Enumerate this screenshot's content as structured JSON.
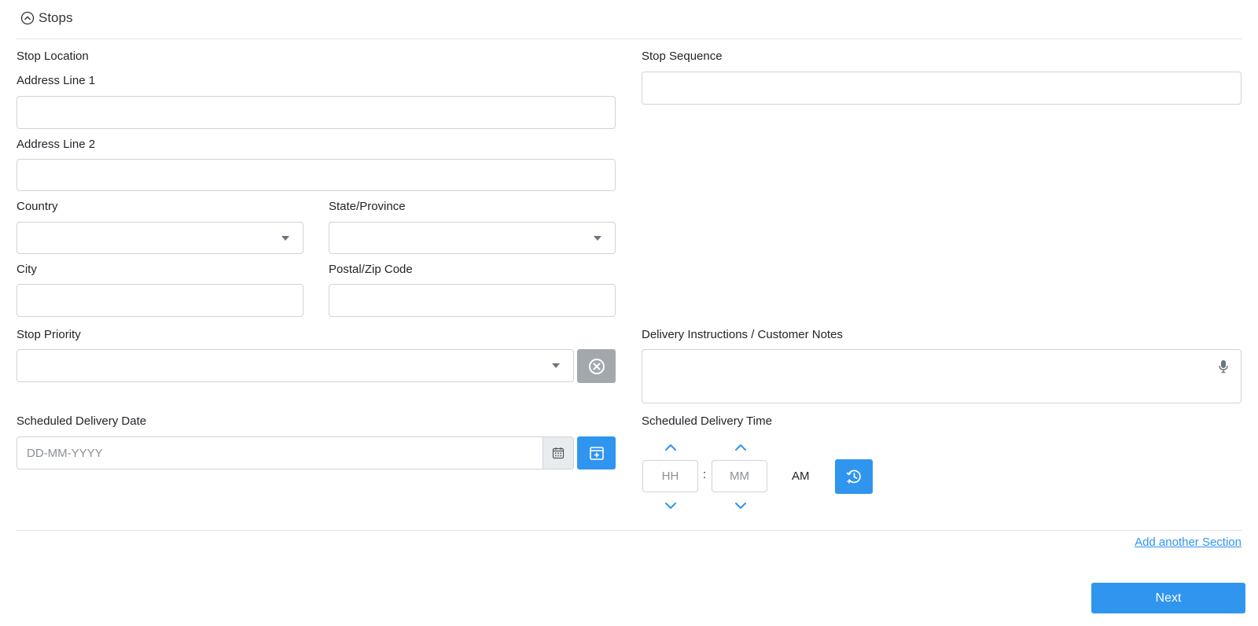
{
  "section": {
    "title": "Stops",
    "toggle_icon": "chevron-up-circle-icon"
  },
  "labels": {
    "stop_location": "Stop Location",
    "address_line_1": "Address Line 1",
    "address_line_2": "Address Line 2",
    "country": "Country",
    "state_province": "State/Province",
    "city": "City",
    "postal_zip": "Postal/Zip Code",
    "stop_priority": "Stop Priority",
    "scheduled_delivery_date": "Scheduled Delivery Date",
    "stop_sequence": "Stop Sequence",
    "delivery_instructions": "Delivery Instructions / Customer Notes",
    "scheduled_delivery_time": "Scheduled Delivery Time"
  },
  "fields": {
    "address_line_1": "",
    "address_line_2": "",
    "country": "",
    "state_province": "",
    "city": "",
    "postal_zip": "",
    "stop_priority": "",
    "stop_sequence": "",
    "delivery_instructions": "",
    "date_placeholder": "DD-MM-YYYY"
  },
  "time": {
    "hour_placeholder": "HH",
    "minute_placeholder": "MM",
    "separator": ":",
    "meridiem": "AM"
  },
  "actions": {
    "add_section": "Add another Section",
    "next": "Next"
  },
  "icons": {
    "clear": "close-circle-icon",
    "calendar": "calendar-icon",
    "calendar_add": "calendar-plus-icon",
    "mic": "microphone-icon",
    "time_history": "clock-history-icon"
  },
  "colors": {
    "primary": "#2f95ef",
    "secondary": "#a3a8ad",
    "border": "#ced4da"
  }
}
